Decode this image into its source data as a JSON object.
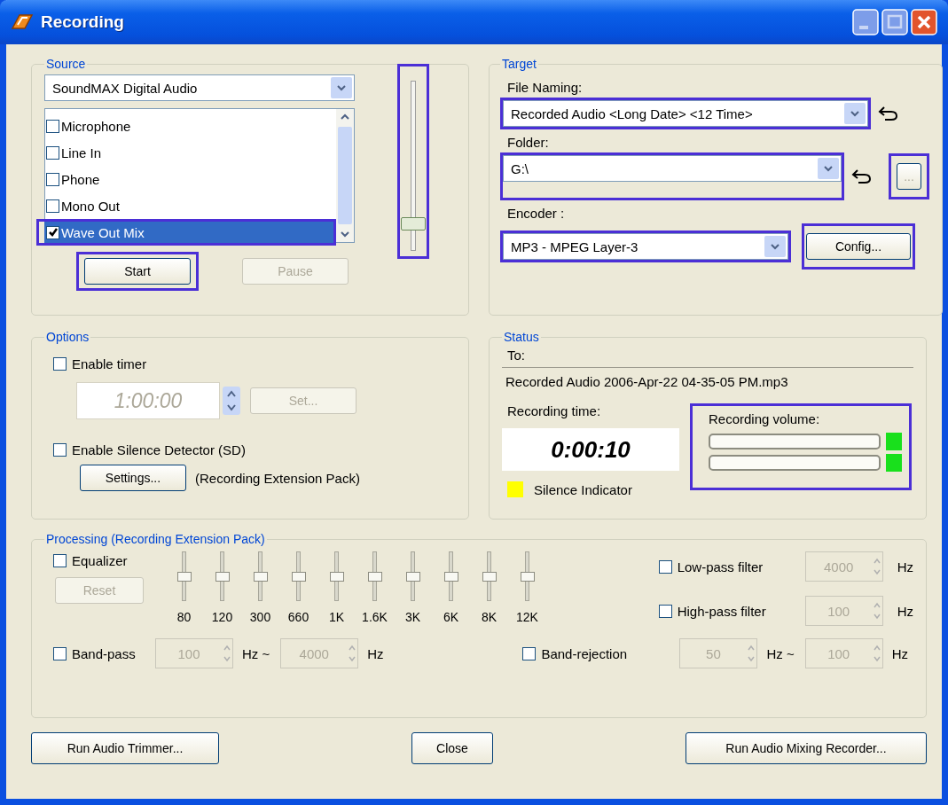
{
  "window": {
    "title": "Recording"
  },
  "source": {
    "title": "Source",
    "device": "SoundMAX Digital Audio",
    "inputs": [
      {
        "label": "Microphone",
        "checked": false,
        "selected": false,
        "highlighted": false
      },
      {
        "label": "Line In",
        "checked": false,
        "selected": false,
        "highlighted": false
      },
      {
        "label": "Phone",
        "checked": false,
        "selected": false,
        "highlighted": false
      },
      {
        "label": "Mono Out",
        "checked": false,
        "selected": false,
        "highlighted": false
      },
      {
        "label": "Wave Out Mix",
        "checked": true,
        "selected": true,
        "highlighted": true
      }
    ],
    "volume": {
      "level": 0.12,
      "highlighted": true
    },
    "buttons": [
      {
        "label": "Start",
        "disabled": false,
        "highlighted": true
      },
      {
        "label": "Pause",
        "disabled": true,
        "highlighted": false
      }
    ]
  },
  "target": {
    "title": "Target",
    "file_naming": {
      "label": "File Naming:",
      "value": "Recorded Audio <Long Date> <12 Time>",
      "highlighted": true
    },
    "folder": {
      "label": "Folder:",
      "value": "G:\\",
      "highlighted": true
    },
    "browse_button": {
      "label": "...",
      "highlighted": true
    },
    "encoder": {
      "label": "Encoder :",
      "value": "MP3 - MPEG Layer-3",
      "highlighted": true
    },
    "config_button": {
      "label": "Config...",
      "highlighted": true
    }
  },
  "options": {
    "title": "Options",
    "timer": {
      "label": "Enable timer",
      "checked": false
    },
    "timer_value": {
      "value": "1:00:00",
      "disabled": true
    },
    "set_button": {
      "label": "Set...",
      "disabled": true
    },
    "silence_detector": {
      "label": "Enable Silence Detector (SD)",
      "checked": false
    },
    "settings_button": {
      "label": "Settings...",
      "disabled": false
    },
    "settings_note": "(Recording Extension Pack)"
  },
  "status": {
    "title": "Status",
    "to_label": "To:",
    "to_value": "Recorded Audio 2006-Apr-22 04-35-05 PM.mp3",
    "time_label": "Recording time:",
    "time_value": "0:00:10",
    "volume": {
      "label": "Recording volume:",
      "highlighted": true,
      "channels": [
        {
          "level": 0,
          "color": "#19e01c"
        },
        {
          "level": 0,
          "color": "#19e01c"
        }
      ]
    },
    "silence_indicator": {
      "label": "Silence Indicator",
      "color": "#ffff00"
    }
  },
  "processing": {
    "title": "Processing (Recording Extension Pack)",
    "equalizer": {
      "label": "Equalizer",
      "checked": false
    },
    "reset_button": {
      "label": "Reset",
      "disabled": true
    },
    "bands": [
      {
        "label": "80",
        "level": 0.5
      },
      {
        "label": "120",
        "level": 0.5
      },
      {
        "label": "300",
        "level": 0.5
      },
      {
        "label": "660",
        "level": 0.5
      },
      {
        "label": "1K",
        "level": 0.5
      },
      {
        "label": "1.6K",
        "level": 0.5
      },
      {
        "label": "3K",
        "level": 0.5
      },
      {
        "label": "6K",
        "level": 0.5
      },
      {
        "label": "8K",
        "level": 0.5
      },
      {
        "label": "12K",
        "level": 0.5
      }
    ],
    "filters": [
      {
        "label": "Low-pass filter",
        "checked": false,
        "value": {
          "value": "4000",
          "disabled": true
        },
        "unit": "Hz"
      },
      {
        "label": "High-pass filter",
        "checked": false,
        "value": {
          "value": "100",
          "disabled": true
        },
        "unit": "Hz"
      }
    ],
    "ranges": [
      {
        "label": "Band-pass",
        "checked": false,
        "from": {
          "value": "100",
          "disabled": true
        },
        "separator": "Hz ~",
        "to": {
          "value": "4000",
          "disabled": true
        },
        "unit": "Hz"
      },
      {
        "label": "Band-rejection",
        "checked": false,
        "from": {
          "value": "50",
          "disabled": true
        },
        "separator": "Hz ~",
        "to": {
          "value": "100",
          "disabled": true
        },
        "unit": "Hz"
      }
    ]
  },
  "buttons": [
    {
      "label": "Run Audio Trimmer..."
    },
    {
      "label": "Close"
    },
    {
      "label": "Run Audio Mixing Recorder..."
    }
  ]
}
